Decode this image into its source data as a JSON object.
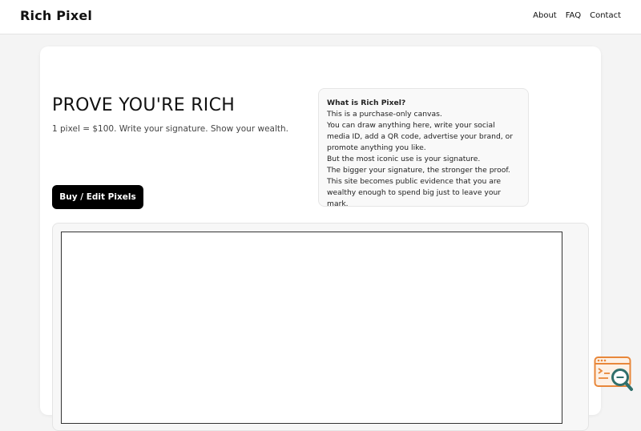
{
  "header": {
    "brand": "Rich Pixel",
    "nav": [
      "About",
      "FAQ",
      "Contact"
    ]
  },
  "hero": {
    "headline": "PROVE YOU'RE RICH",
    "tagline": "1 pixel = $100. Write your signature. Show your wealth.",
    "button_label": "Buy / Edit Pixels"
  },
  "info": {
    "question": "What is Rich Pixel?",
    "lines": [
      "This is a purchase-only canvas.",
      "You can draw anything here, write your social media ID, add a QR code, advertise your brand, or promote anything you like.",
      "But the most iconic use is your signature.",
      "The bigger your signature, the stronger the proof. This site becomes public evidence that you are wealthy enough to spend big just to leave your mark."
    ]
  },
  "widget": {
    "icon": "search-code-icon",
    "accent": "#e8873a",
    "teal": "#2f6f6b"
  },
  "colors": {
    "button_bg": "#000000",
    "page_bg": "#f4f4f4"
  }
}
